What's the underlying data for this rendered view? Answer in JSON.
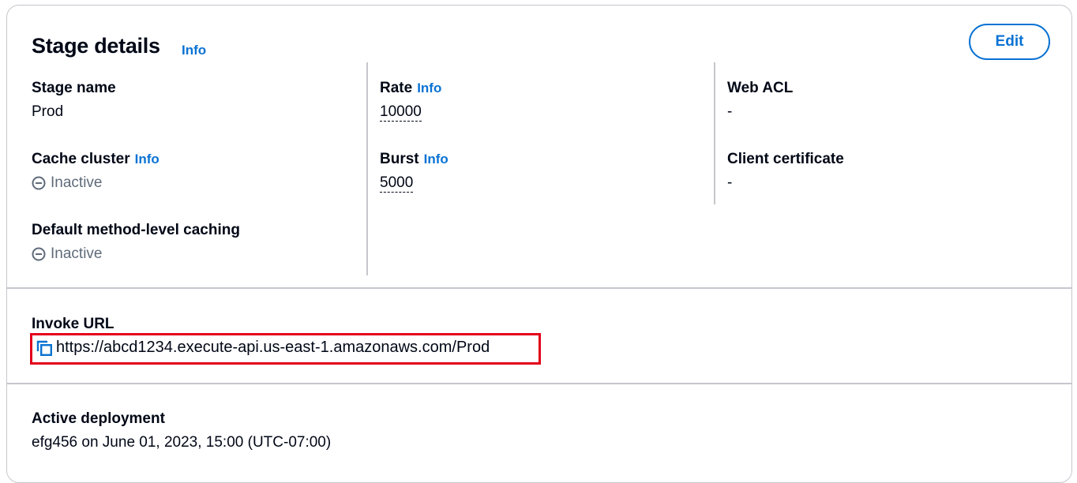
{
  "header": {
    "title": "Stage details",
    "info_label": "Info",
    "edit_label": "Edit"
  },
  "fields": {
    "stage_name": {
      "label": "Stage name",
      "value": "Prod"
    },
    "cache_cluster": {
      "label": "Cache cluster",
      "info_label": "Info",
      "value": "Inactive"
    },
    "default_caching": {
      "label": "Default method-level caching",
      "value": "Inactive"
    },
    "rate": {
      "label": "Rate",
      "info_label": "Info",
      "value": "10000"
    },
    "burst": {
      "label": "Burst",
      "info_label": "Info",
      "value": "5000"
    },
    "web_acl": {
      "label": "Web ACL",
      "value": "-"
    },
    "client_certificate": {
      "label": "Client certificate",
      "value": "-"
    }
  },
  "invoke": {
    "label": "Invoke URL",
    "url": "https://abcd1234.execute-api.us-east-1.amazonaws.com/Prod",
    "icon": "copy-icon"
  },
  "deployment": {
    "label": "Active deployment",
    "value": "efg456 on June 01, 2023, 15:00 (UTC-07:00)"
  },
  "colors": {
    "accent": "#0972d3",
    "text": "#000716",
    "muted": "#5f6b7a",
    "border": "#c6c6cd",
    "highlight": "#e3001b"
  }
}
